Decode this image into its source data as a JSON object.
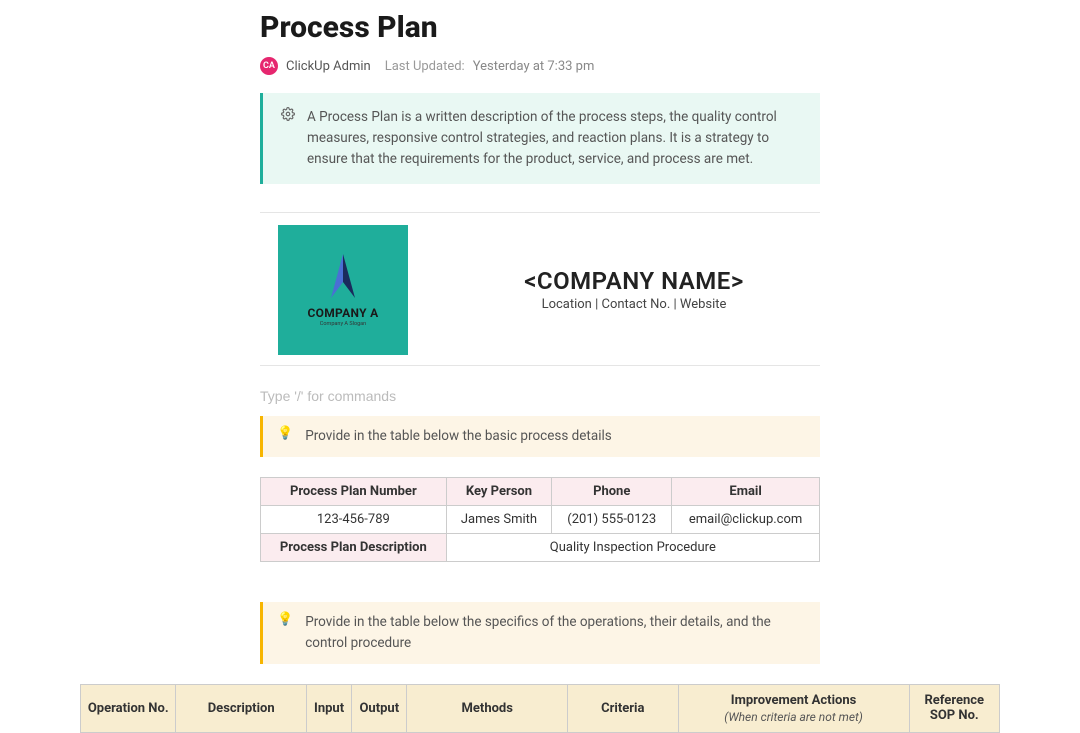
{
  "page": {
    "title": "Process Plan",
    "author_initials": "CA",
    "author_name": "ClickUp Admin",
    "last_updated_label": "Last Updated:",
    "last_updated_value": "Yesterday at 7:33 pm"
  },
  "callout": {
    "text": "A Process Plan is a written description of the process steps, the quality control measures, responsive control strategies, and reaction plans. It is a strategy to ensure that the requirements for the product, service, and process are met."
  },
  "company": {
    "logo_label": "COMPANY A",
    "logo_tag": "Company A Slogan",
    "name_placeholder": "<COMPANY NAME>",
    "subline": "Location | Contact No. | Website"
  },
  "command_placeholder": "Type '/' for commands",
  "hint1": {
    "text": "Provide in the table below the basic process details"
  },
  "details_table": {
    "headers": {
      "plan_number": "Process Plan Number",
      "key_person": "Key Person",
      "phone": "Phone",
      "email": "Email",
      "plan_description": "Process Plan Description"
    },
    "values": {
      "plan_number": "123-456-789",
      "key_person": "James Smith",
      "phone": "(201) 555-0123",
      "email": "email@clickup.com",
      "plan_description": "Quality Inspection Procedure"
    }
  },
  "hint2": {
    "text": "Provide in the table below the specifics of the operations, their details, and the control procedure"
  },
  "ops_table": {
    "headers": {
      "op_no": "Operation No.",
      "description": "Description",
      "input": "Input",
      "output": "Output",
      "methods": "Methods",
      "criteria": "Criteria",
      "improvement": "Improvement Actions",
      "improvement_sub": "(When criteria are not met)",
      "reference": "Reference SOP No."
    }
  }
}
